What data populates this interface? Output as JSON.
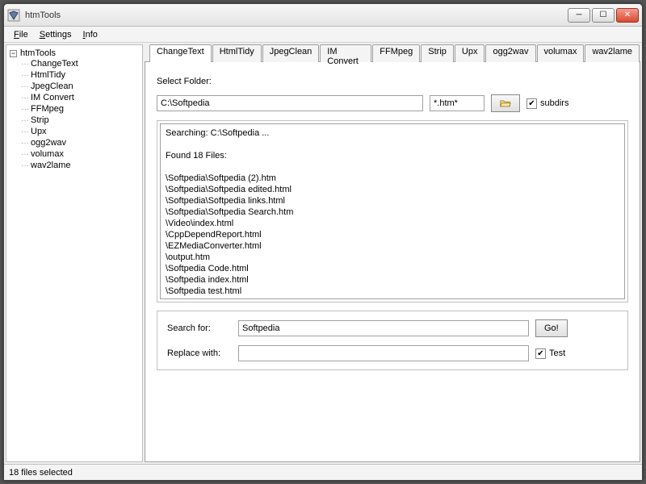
{
  "window": {
    "title": "htmTools"
  },
  "menubar": {
    "file": "File",
    "settings": "Settings",
    "info": "Info"
  },
  "tree": {
    "root": "htmTools",
    "items": [
      "ChangeText",
      "HtmlTidy",
      "JpegClean",
      "IM Convert",
      "FFMpeg",
      "Strip",
      "Upx",
      "ogg2wav",
      "volumax",
      "wav2lame"
    ]
  },
  "tabs": [
    "ChangeText",
    "HtmlTidy",
    "JpegClean",
    "IM Convert",
    "FFMpeg",
    "Strip",
    "Upx",
    "ogg2wav",
    "volumax",
    "wav2lame"
  ],
  "panel": {
    "select_folder_label": "Select Folder:",
    "folder_value": "C:\\Softpedia",
    "filter_value": "*.htm*",
    "subdirs_label": "subdirs",
    "subdirs_checked": true,
    "search_for_label": "Search for:",
    "search_for_value": "Softpedia",
    "replace_with_label": "Replace with:",
    "replace_with_value": "",
    "go_label": "Go!",
    "test_label": "Test",
    "test_checked": true,
    "results_text": "Searching: C:\\Softpedia ...\n\nFound 18 Files:\n\n\\Softpedia\\Softpedia (2).htm\n\\Softpedia\\Softpedia edited.html\n\\Softpedia\\Softpedia links.html\n\\Softpedia\\Softpedia Search.htm\n\\Video\\index.html\n\\CppDependReport.html\n\\EZMediaConverter.html\n\\output.htm\n\\Softpedia Code.html\n\\Softpedia index.html\n\\Softpedia test.html\n\\Softpedia tested.html\n\\softpedia.htm"
  },
  "statusbar": {
    "text": "18 files selected"
  }
}
